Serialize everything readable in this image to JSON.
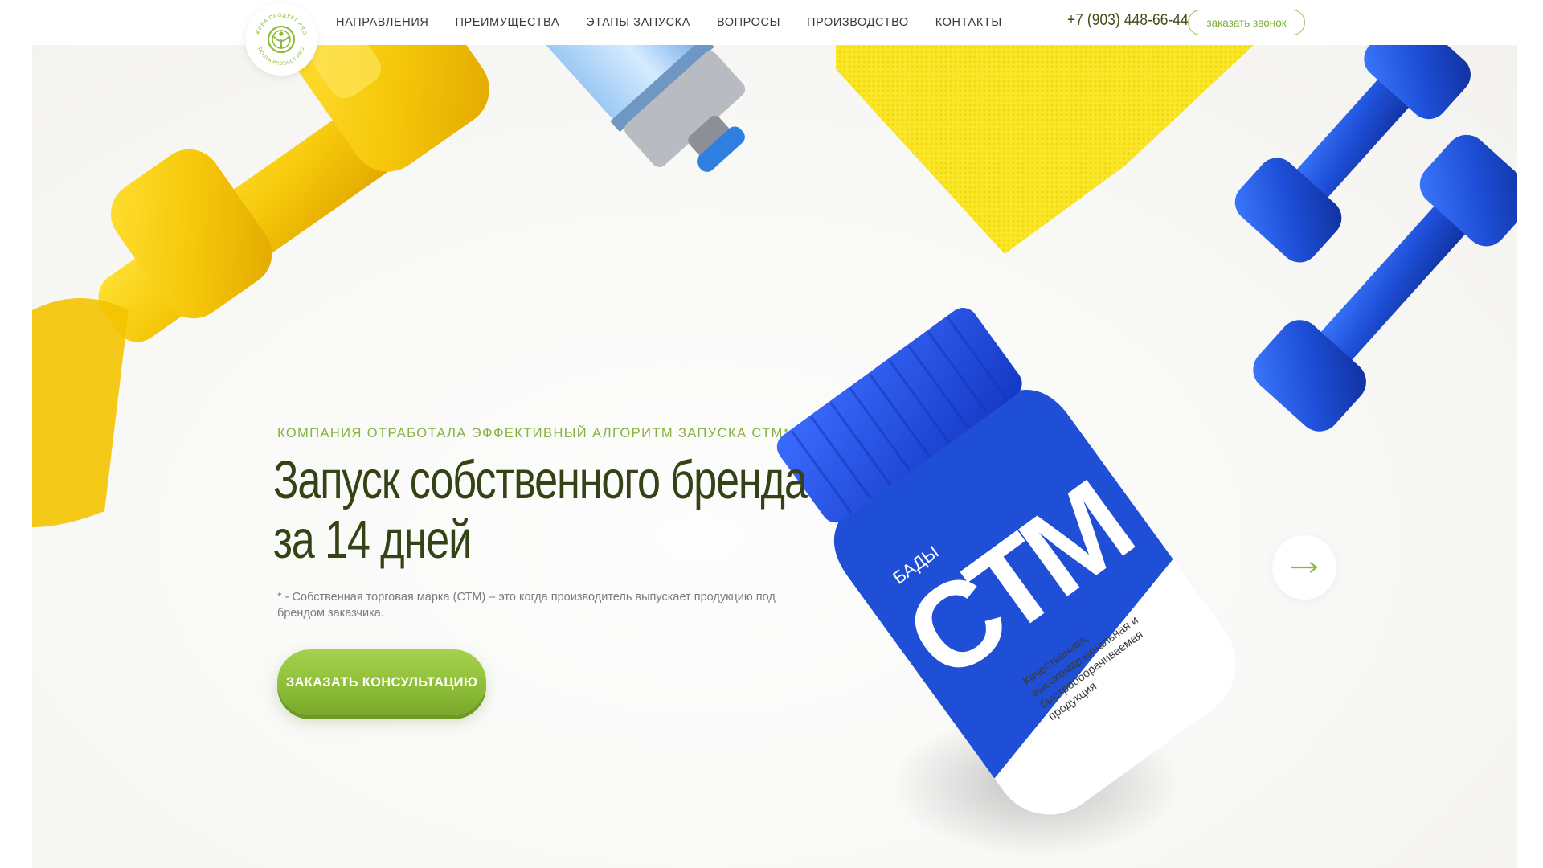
{
  "header": {
    "logo": {
      "top_text": "ЖИВА ПРОДУКТ PRO",
      "bottom_text": "DZHIVA PRODUCT PRO"
    },
    "nav": [
      {
        "label": "НАПРАВЛЕНИЯ"
      },
      {
        "label": "ПРЕИМУЩЕСТВА"
      },
      {
        "label": "ЭТАПЫ ЗАПУСКА"
      },
      {
        "label": "ВОПРОСЫ"
      },
      {
        "label": "ПРОИЗВОДСТВО"
      },
      {
        "label": "КОНТАКТЫ"
      }
    ],
    "phone": "+7 (903) 448-66-44",
    "callback_label": "заказать звонок"
  },
  "hero": {
    "subtitle": "КОМПАНИЯ ОТРАБОТАЛА ЭФФЕКТИВНЫЙ АЛГОРИТМ ЗАПУСКА СТМ*",
    "title_line1": "Запуск собственного бренда",
    "title_line2": "за 14 дней",
    "footnote": "* - Собственная торговая марка (СТМ) – это когда производитель выпускает продукцию под брендом заказчика.",
    "cta_label": "ЗАКАЗАТЬ КОНСУЛЬТАЦИЮ",
    "next_icon": "arrow-right-icon"
  },
  "product": {
    "category": "БАДЫ",
    "brand": "СТМ",
    "desc_line1": "Качественная,",
    "desc_line2": "высокомаржинальная и",
    "desc_line3": "быстрооборачиваемая",
    "desc_line4": "продукция"
  },
  "colors": {
    "brand_green": "#8cbc37",
    "title_dark": "#344315",
    "jar_blue": "#1f4fd6"
  }
}
